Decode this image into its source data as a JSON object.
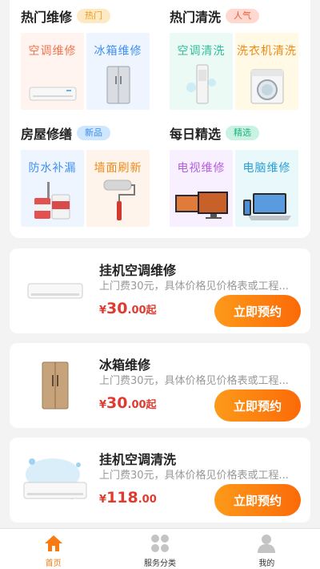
{
  "categories": [
    {
      "title": "热门维修",
      "tag": "热门",
      "tag_bg": "#fdeac4",
      "tag_color": "#f29a1e",
      "tiles": [
        {
          "label": "空调维修",
          "color": "#f2744e",
          "bg": "#fff4ef",
          "icon": "ac-unit-icon"
        },
        {
          "label": "冰箱维修",
          "color": "#3f8ff2",
          "bg": "#eef5ff",
          "icon": "fridge-icon"
        }
      ]
    },
    {
      "title": "热门清洗",
      "tag": "人气",
      "tag_bg": "#ffd9cf",
      "tag_color": "#f05a3b",
      "tiles": [
        {
          "label": "空调清洗",
          "color": "#2fbf9a",
          "bg": "#ecfaf5",
          "icon": "standing-ac-icon"
        },
        {
          "label": "洗衣机清洗",
          "color": "#f08a16",
          "bg": "#fff9e6",
          "icon": "washing-machine-icon"
        }
      ]
    },
    {
      "title": "房屋修缮",
      "tag": "新品",
      "tag_bg": "#cfe6ff",
      "tag_color": "#3c8cec",
      "tiles": [
        {
          "label": "防水补漏",
          "color": "#3f8ff2",
          "bg": "#eef5ff",
          "icon": "paint-buckets-icon"
        },
        {
          "label": "墙面刷新",
          "color": "#f08a16",
          "bg": "#fff4ec",
          "icon": "paint-roller-icon"
        }
      ]
    },
    {
      "title": "每日精选",
      "tag": "精选",
      "tag_bg": "#c8f2e2",
      "tag_color": "#22b383",
      "tiles": [
        {
          "label": "电视维修",
          "color": "#b45de0",
          "bg": "#f8efff",
          "icon": "tv-icon"
        },
        {
          "label": "电脑维修",
          "color": "#2a9fd6",
          "bg": "#e9f8fb",
          "icon": "laptop-icon"
        }
      ]
    }
  ],
  "services": [
    {
      "name": "挂机空调维修",
      "desc": "上门费30元，具体价格见价格表或工程...",
      "currency": "¥",
      "price_int": "30",
      "price_dec": ".00",
      "price_suffix": "起",
      "button": "立即预约",
      "icon": "wall-ac-icon"
    },
    {
      "name": "冰箱维修",
      "desc": "上门费30元，具体价格见价格表或工程...",
      "currency": "¥",
      "price_int": "30",
      "price_dec": ".00",
      "price_suffix": "起",
      "button": "立即预约",
      "icon": "fridge-icon"
    },
    {
      "name": "挂机空调清洗",
      "desc": "上门费30元，具体价格见价格表或工程...",
      "currency": "¥",
      "price_int": "118",
      "price_dec": ".00",
      "price_suffix": "",
      "button": "立即预约",
      "icon": "wall-ac-splash-icon"
    }
  ],
  "tabbar": {
    "accent": "#fa7a0f",
    "tabs": [
      {
        "label": "首页",
        "icon": "home-icon",
        "active": true
      },
      {
        "label": "服务分类",
        "icon": "grid-icon",
        "active": false
      },
      {
        "label": "我的",
        "icon": "person-icon",
        "active": false
      }
    ]
  }
}
